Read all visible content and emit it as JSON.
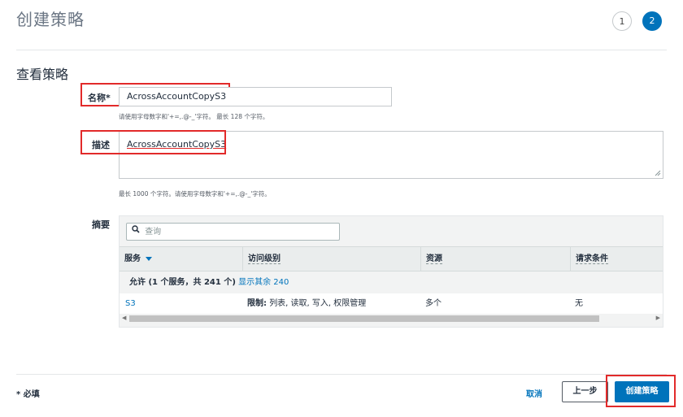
{
  "header": {
    "title": "创建策略",
    "steps": [
      "1",
      "2"
    ]
  },
  "section": {
    "title": "查看策略"
  },
  "form": {
    "name_label": "名称*",
    "name_value": "AcrossAccountCopyS3",
    "name_hint": "请使用字母数字和'+=,.@-_'字符。 最长 128 个字符。",
    "desc_label": "描述",
    "desc_value": "AcrossAccountCopyS3",
    "desc_hint": "最长 1000 个字符。请使用字母数字和'+=,.@-_'字符。"
  },
  "summary": {
    "label": "摘要",
    "search_placeholder": "查询",
    "columns": [
      "服务",
      "访问级别",
      "资源",
      "请求条件"
    ],
    "group_text": "允许 (1 个服务，共 241 个)",
    "group_link": "显示其余 240",
    "rows": [
      {
        "service": "S3",
        "access_bold": "限制:",
        "access_rest": "列表, 读取, 写入, 权限管理",
        "resource": "多个",
        "condition": "无"
      }
    ]
  },
  "footer": {
    "required_note": "* 必填",
    "cancel": "取消",
    "previous": "上一步",
    "create": "创建策略"
  },
  "colors": {
    "accent": "#0073bb",
    "primary_button": "#0073bb",
    "highlight": "#e22a2a"
  }
}
